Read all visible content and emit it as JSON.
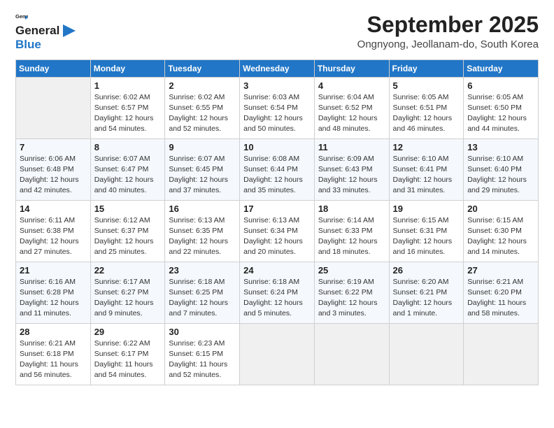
{
  "logo": {
    "general": "General",
    "blue": "Blue"
  },
  "title": "September 2025",
  "subtitle": "Ongnyong, Jeollanam-do, South Korea",
  "days_of_week": [
    "Sunday",
    "Monday",
    "Tuesday",
    "Wednesday",
    "Thursday",
    "Friday",
    "Saturday"
  ],
  "weeks": [
    [
      {
        "num": "",
        "detail": ""
      },
      {
        "num": "1",
        "detail": "Sunrise: 6:02 AM\nSunset: 6:57 PM\nDaylight: 12 hours\nand 54 minutes."
      },
      {
        "num": "2",
        "detail": "Sunrise: 6:02 AM\nSunset: 6:55 PM\nDaylight: 12 hours\nand 52 minutes."
      },
      {
        "num": "3",
        "detail": "Sunrise: 6:03 AM\nSunset: 6:54 PM\nDaylight: 12 hours\nand 50 minutes."
      },
      {
        "num": "4",
        "detail": "Sunrise: 6:04 AM\nSunset: 6:52 PM\nDaylight: 12 hours\nand 48 minutes."
      },
      {
        "num": "5",
        "detail": "Sunrise: 6:05 AM\nSunset: 6:51 PM\nDaylight: 12 hours\nand 46 minutes."
      },
      {
        "num": "6",
        "detail": "Sunrise: 6:05 AM\nSunset: 6:50 PM\nDaylight: 12 hours\nand 44 minutes."
      }
    ],
    [
      {
        "num": "7",
        "detail": "Sunrise: 6:06 AM\nSunset: 6:48 PM\nDaylight: 12 hours\nand 42 minutes."
      },
      {
        "num": "8",
        "detail": "Sunrise: 6:07 AM\nSunset: 6:47 PM\nDaylight: 12 hours\nand 40 minutes."
      },
      {
        "num": "9",
        "detail": "Sunrise: 6:07 AM\nSunset: 6:45 PM\nDaylight: 12 hours\nand 37 minutes."
      },
      {
        "num": "10",
        "detail": "Sunrise: 6:08 AM\nSunset: 6:44 PM\nDaylight: 12 hours\nand 35 minutes."
      },
      {
        "num": "11",
        "detail": "Sunrise: 6:09 AM\nSunset: 6:43 PM\nDaylight: 12 hours\nand 33 minutes."
      },
      {
        "num": "12",
        "detail": "Sunrise: 6:10 AM\nSunset: 6:41 PM\nDaylight: 12 hours\nand 31 minutes."
      },
      {
        "num": "13",
        "detail": "Sunrise: 6:10 AM\nSunset: 6:40 PM\nDaylight: 12 hours\nand 29 minutes."
      }
    ],
    [
      {
        "num": "14",
        "detail": "Sunrise: 6:11 AM\nSunset: 6:38 PM\nDaylight: 12 hours\nand 27 minutes."
      },
      {
        "num": "15",
        "detail": "Sunrise: 6:12 AM\nSunset: 6:37 PM\nDaylight: 12 hours\nand 25 minutes."
      },
      {
        "num": "16",
        "detail": "Sunrise: 6:13 AM\nSunset: 6:35 PM\nDaylight: 12 hours\nand 22 minutes."
      },
      {
        "num": "17",
        "detail": "Sunrise: 6:13 AM\nSunset: 6:34 PM\nDaylight: 12 hours\nand 20 minutes."
      },
      {
        "num": "18",
        "detail": "Sunrise: 6:14 AM\nSunset: 6:33 PM\nDaylight: 12 hours\nand 18 minutes."
      },
      {
        "num": "19",
        "detail": "Sunrise: 6:15 AM\nSunset: 6:31 PM\nDaylight: 12 hours\nand 16 minutes."
      },
      {
        "num": "20",
        "detail": "Sunrise: 6:15 AM\nSunset: 6:30 PM\nDaylight: 12 hours\nand 14 minutes."
      }
    ],
    [
      {
        "num": "21",
        "detail": "Sunrise: 6:16 AM\nSunset: 6:28 PM\nDaylight: 12 hours\nand 11 minutes."
      },
      {
        "num": "22",
        "detail": "Sunrise: 6:17 AM\nSunset: 6:27 PM\nDaylight: 12 hours\nand 9 minutes."
      },
      {
        "num": "23",
        "detail": "Sunrise: 6:18 AM\nSunset: 6:25 PM\nDaylight: 12 hours\nand 7 minutes."
      },
      {
        "num": "24",
        "detail": "Sunrise: 6:18 AM\nSunset: 6:24 PM\nDaylight: 12 hours\nand 5 minutes."
      },
      {
        "num": "25",
        "detail": "Sunrise: 6:19 AM\nSunset: 6:22 PM\nDaylight: 12 hours\nand 3 minutes."
      },
      {
        "num": "26",
        "detail": "Sunrise: 6:20 AM\nSunset: 6:21 PM\nDaylight: 12 hours\nand 1 minute."
      },
      {
        "num": "27",
        "detail": "Sunrise: 6:21 AM\nSunset: 6:20 PM\nDaylight: 11 hours\nand 58 minutes."
      }
    ],
    [
      {
        "num": "28",
        "detail": "Sunrise: 6:21 AM\nSunset: 6:18 PM\nDaylight: 11 hours\nand 56 minutes."
      },
      {
        "num": "29",
        "detail": "Sunrise: 6:22 AM\nSunset: 6:17 PM\nDaylight: 11 hours\nand 54 minutes."
      },
      {
        "num": "30",
        "detail": "Sunrise: 6:23 AM\nSunset: 6:15 PM\nDaylight: 11 hours\nand 52 minutes."
      },
      {
        "num": "",
        "detail": ""
      },
      {
        "num": "",
        "detail": ""
      },
      {
        "num": "",
        "detail": ""
      },
      {
        "num": "",
        "detail": ""
      }
    ]
  ]
}
